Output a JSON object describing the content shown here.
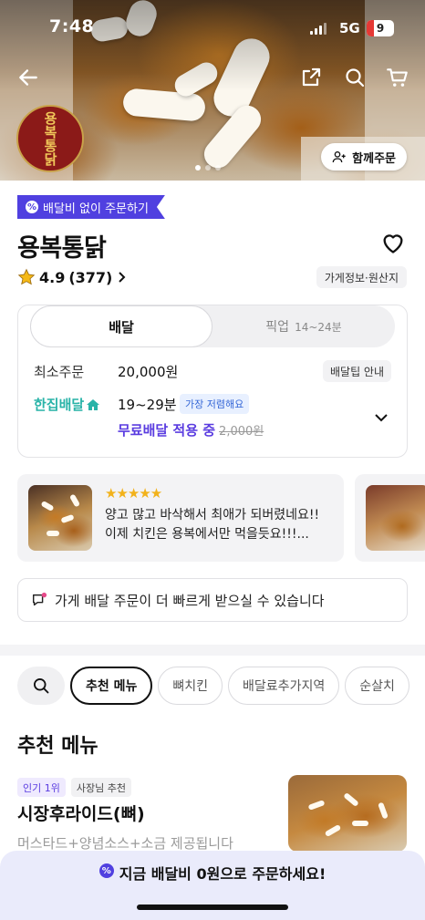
{
  "status_bar": {
    "time": "7:48",
    "network": "5G",
    "battery": "9"
  },
  "store": {
    "logo_text": "용복통닭",
    "promo_tag": "배달비 없이 주문하기",
    "name": "용복통닭",
    "rating": "4.9",
    "review_count": "(377)",
    "info_button": "가게정보·원산지"
  },
  "header": {
    "together_order": "함께주문"
  },
  "delivery": {
    "tab_delivery": "배달",
    "tab_pickup": "픽업",
    "pickup_time": "14~24분",
    "min_order_label": "최소주문",
    "min_order_value": "20,000원",
    "tip_button": "배달팁 안내",
    "hanjip_label": "한집배달",
    "time_range": "19~29분",
    "cheap_badge": "가장 저렴해요",
    "free_text": "무료배달 적용 중",
    "original_fee": "2,000원"
  },
  "review": {
    "stars": "★★★★★",
    "line1": "양고 많고 바삭해서 최애가 되버렸네요!!",
    "line2": "이제 치킨은 용복에서만 먹을듯요!!!..."
  },
  "notice": {
    "text": "가게 배달 주문이 더 빠르게 받으실 수 있습니다"
  },
  "menu_tabs": [
    "추천 메뉴",
    "뼈치킨",
    "배달료추가지역",
    "순살치"
  ],
  "section": {
    "title": "추천 메뉴"
  },
  "menu_item": {
    "badge_rank": "인기 1위",
    "badge_owner": "사장님 추천",
    "name": "시장후라이드(뼈)",
    "desc": "머스타드+양념소스+소금 제공됩니다"
  },
  "cta": {
    "text": "지금 배달비 0원으로 주문하세요!"
  },
  "colors": {
    "accent": "#5040e0",
    "free_delivery": "#5a3ce0",
    "hanjip": "#29b3a8",
    "star": "#f2b21b"
  }
}
